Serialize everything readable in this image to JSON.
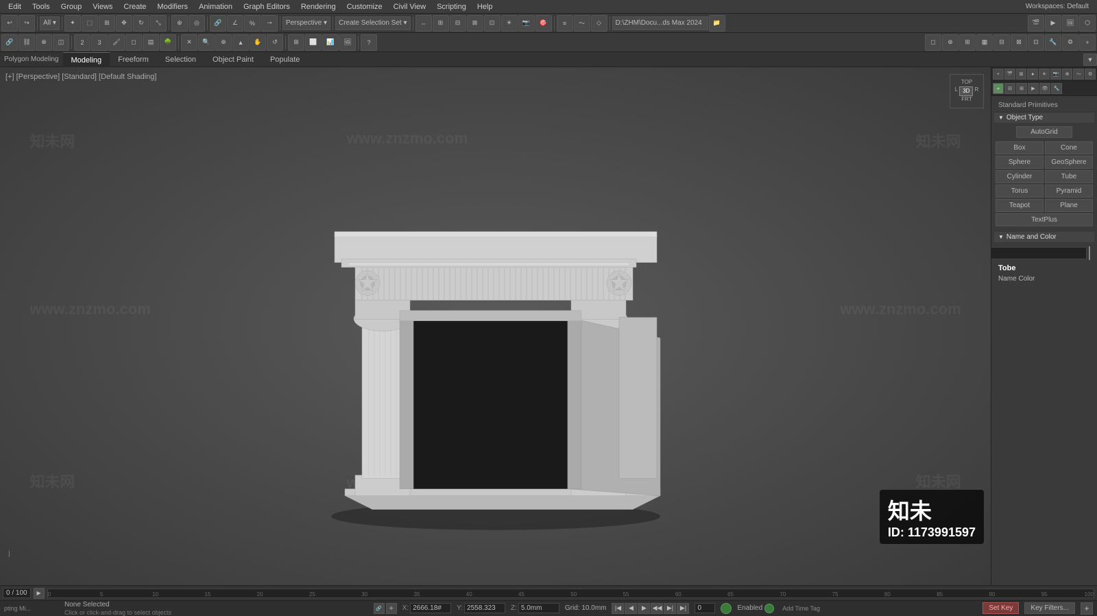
{
  "menubar": {
    "items": [
      "Edit",
      "Tools",
      "Group",
      "Views",
      "Create",
      "Modifiers",
      "Animation",
      "Graph Editors",
      "Rendering",
      "Customize",
      "Civil View",
      "Scripting",
      "Help"
    ]
  },
  "toolbar1": {
    "dropdowns": [
      "All",
      "Perspective"
    ],
    "buttons": [
      "undo",
      "redo",
      "select",
      "move",
      "rotate",
      "scale",
      "link",
      "unlink",
      "bind",
      "layer",
      "mirror",
      "array",
      "render",
      "quick-render",
      "viewport-bg"
    ]
  },
  "toolbar2": {
    "mode_label": "Polygon Modeling",
    "tabs": [
      "Modeling",
      "Freeform",
      "Selection",
      "Object Paint",
      "Populate"
    ]
  },
  "viewport": {
    "label": "[+] [Perspective] [Standard] [Default Shading]",
    "background_color": "#4a4a4a"
  },
  "right_panel": {
    "section_label": "Standard Primitives",
    "object_type_header": "Object Type",
    "autogrid_label": "AutoGrid",
    "primitives": [
      "Box",
      "Cone",
      "Sphere",
      "GeoSphere",
      "Cylinder",
      "Tube",
      "Torus",
      "Pyramid",
      "Teapot",
      "Plane",
      "TextPlus"
    ],
    "name_color_header": "Name and Color",
    "color_swatch": "#e05080"
  },
  "timeline": {
    "frame_range": "0 / 100",
    "markers": [
      "0",
      "5",
      "10",
      "15",
      "20",
      "25",
      "30",
      "35",
      "40",
      "45",
      "50",
      "55",
      "60",
      "65",
      "70",
      "75",
      "80",
      "85",
      "90",
      "95",
      "100"
    ]
  },
  "status_bar": {
    "selection": "None Selected",
    "hint": "Click or click-and-drag to select objects",
    "coords": {
      "x_label": "X:",
      "x_value": "2666.18#",
      "y_label": "Y:",
      "y_value": "2558.323",
      "z_label": "Z:",
      "z_value": "5.0mm"
    },
    "grid_label": "Grid: 10.0mm",
    "enabled_label": "Enabled",
    "set_key": "Set Key",
    "key_filters": "Key Filters..."
  },
  "workspace": {
    "label": "Workspaces: Default"
  },
  "filepath": {
    "label": "D:\\ZHM\\Docu...ds Max 2024"
  },
  "tobe_label": "Tobe",
  "name_color_label": "Name Color",
  "id_badge": {
    "brand": "知未",
    "id_label": "ID: 1173991597"
  }
}
